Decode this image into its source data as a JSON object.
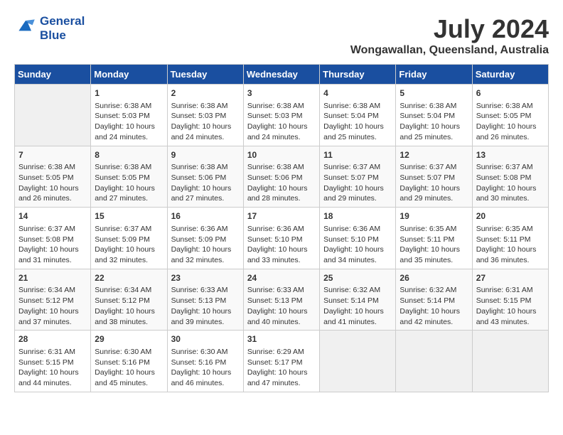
{
  "header": {
    "logo_line1": "General",
    "logo_line2": "Blue",
    "month_year": "July 2024",
    "location": "Wongawallan, Queensland, Australia"
  },
  "weekdays": [
    "Sunday",
    "Monday",
    "Tuesday",
    "Wednesday",
    "Thursday",
    "Friday",
    "Saturday"
  ],
  "weeks": [
    [
      {
        "day": "",
        "rise": "",
        "set": "",
        "daylight": ""
      },
      {
        "day": "1",
        "rise": "Sunrise: 6:38 AM",
        "set": "Sunset: 5:03 PM",
        "daylight": "Daylight: 10 hours and 24 minutes."
      },
      {
        "day": "2",
        "rise": "Sunrise: 6:38 AM",
        "set": "Sunset: 5:03 PM",
        "daylight": "Daylight: 10 hours and 24 minutes."
      },
      {
        "day": "3",
        "rise": "Sunrise: 6:38 AM",
        "set": "Sunset: 5:03 PM",
        "daylight": "Daylight: 10 hours and 24 minutes."
      },
      {
        "day": "4",
        "rise": "Sunrise: 6:38 AM",
        "set": "Sunset: 5:04 PM",
        "daylight": "Daylight: 10 hours and 25 minutes."
      },
      {
        "day": "5",
        "rise": "Sunrise: 6:38 AM",
        "set": "Sunset: 5:04 PM",
        "daylight": "Daylight: 10 hours and 25 minutes."
      },
      {
        "day": "6",
        "rise": "Sunrise: 6:38 AM",
        "set": "Sunset: 5:05 PM",
        "daylight": "Daylight: 10 hours and 26 minutes."
      }
    ],
    [
      {
        "day": "7",
        "rise": "Sunrise: 6:38 AM",
        "set": "Sunset: 5:05 PM",
        "daylight": "Daylight: 10 hours and 26 minutes."
      },
      {
        "day": "8",
        "rise": "Sunrise: 6:38 AM",
        "set": "Sunset: 5:05 PM",
        "daylight": "Daylight: 10 hours and 27 minutes."
      },
      {
        "day": "9",
        "rise": "Sunrise: 6:38 AM",
        "set": "Sunset: 5:06 PM",
        "daylight": "Daylight: 10 hours and 27 minutes."
      },
      {
        "day": "10",
        "rise": "Sunrise: 6:38 AM",
        "set": "Sunset: 5:06 PM",
        "daylight": "Daylight: 10 hours and 28 minutes."
      },
      {
        "day": "11",
        "rise": "Sunrise: 6:37 AM",
        "set": "Sunset: 5:07 PM",
        "daylight": "Daylight: 10 hours and 29 minutes."
      },
      {
        "day": "12",
        "rise": "Sunrise: 6:37 AM",
        "set": "Sunset: 5:07 PM",
        "daylight": "Daylight: 10 hours and 29 minutes."
      },
      {
        "day": "13",
        "rise": "Sunrise: 6:37 AM",
        "set": "Sunset: 5:08 PM",
        "daylight": "Daylight: 10 hours and 30 minutes."
      }
    ],
    [
      {
        "day": "14",
        "rise": "Sunrise: 6:37 AM",
        "set": "Sunset: 5:08 PM",
        "daylight": "Daylight: 10 hours and 31 minutes."
      },
      {
        "day": "15",
        "rise": "Sunrise: 6:37 AM",
        "set": "Sunset: 5:09 PM",
        "daylight": "Daylight: 10 hours and 32 minutes."
      },
      {
        "day": "16",
        "rise": "Sunrise: 6:36 AM",
        "set": "Sunset: 5:09 PM",
        "daylight": "Daylight: 10 hours and 32 minutes."
      },
      {
        "day": "17",
        "rise": "Sunrise: 6:36 AM",
        "set": "Sunset: 5:10 PM",
        "daylight": "Daylight: 10 hours and 33 minutes."
      },
      {
        "day": "18",
        "rise": "Sunrise: 6:36 AM",
        "set": "Sunset: 5:10 PM",
        "daylight": "Daylight: 10 hours and 34 minutes."
      },
      {
        "day": "19",
        "rise": "Sunrise: 6:35 AM",
        "set": "Sunset: 5:11 PM",
        "daylight": "Daylight: 10 hours and 35 minutes."
      },
      {
        "day": "20",
        "rise": "Sunrise: 6:35 AM",
        "set": "Sunset: 5:11 PM",
        "daylight": "Daylight: 10 hours and 36 minutes."
      }
    ],
    [
      {
        "day": "21",
        "rise": "Sunrise: 6:34 AM",
        "set": "Sunset: 5:12 PM",
        "daylight": "Daylight: 10 hours and 37 minutes."
      },
      {
        "day": "22",
        "rise": "Sunrise: 6:34 AM",
        "set": "Sunset: 5:12 PM",
        "daylight": "Daylight: 10 hours and 38 minutes."
      },
      {
        "day": "23",
        "rise": "Sunrise: 6:33 AM",
        "set": "Sunset: 5:13 PM",
        "daylight": "Daylight: 10 hours and 39 minutes."
      },
      {
        "day": "24",
        "rise": "Sunrise: 6:33 AM",
        "set": "Sunset: 5:13 PM",
        "daylight": "Daylight: 10 hours and 40 minutes."
      },
      {
        "day": "25",
        "rise": "Sunrise: 6:32 AM",
        "set": "Sunset: 5:14 PM",
        "daylight": "Daylight: 10 hours and 41 minutes."
      },
      {
        "day": "26",
        "rise": "Sunrise: 6:32 AM",
        "set": "Sunset: 5:14 PM",
        "daylight": "Daylight: 10 hours and 42 minutes."
      },
      {
        "day": "27",
        "rise": "Sunrise: 6:31 AM",
        "set": "Sunset: 5:15 PM",
        "daylight": "Daylight: 10 hours and 43 minutes."
      }
    ],
    [
      {
        "day": "28",
        "rise": "Sunrise: 6:31 AM",
        "set": "Sunset: 5:15 PM",
        "daylight": "Daylight: 10 hours and 44 minutes."
      },
      {
        "day": "29",
        "rise": "Sunrise: 6:30 AM",
        "set": "Sunset: 5:16 PM",
        "daylight": "Daylight: 10 hours and 45 minutes."
      },
      {
        "day": "30",
        "rise": "Sunrise: 6:30 AM",
        "set": "Sunset: 5:16 PM",
        "daylight": "Daylight: 10 hours and 46 minutes."
      },
      {
        "day": "31",
        "rise": "Sunrise: 6:29 AM",
        "set": "Sunset: 5:17 PM",
        "daylight": "Daylight: 10 hours and 47 minutes."
      },
      {
        "day": "",
        "rise": "",
        "set": "",
        "daylight": ""
      },
      {
        "day": "",
        "rise": "",
        "set": "",
        "daylight": ""
      },
      {
        "day": "",
        "rise": "",
        "set": "",
        "daylight": ""
      }
    ]
  ]
}
